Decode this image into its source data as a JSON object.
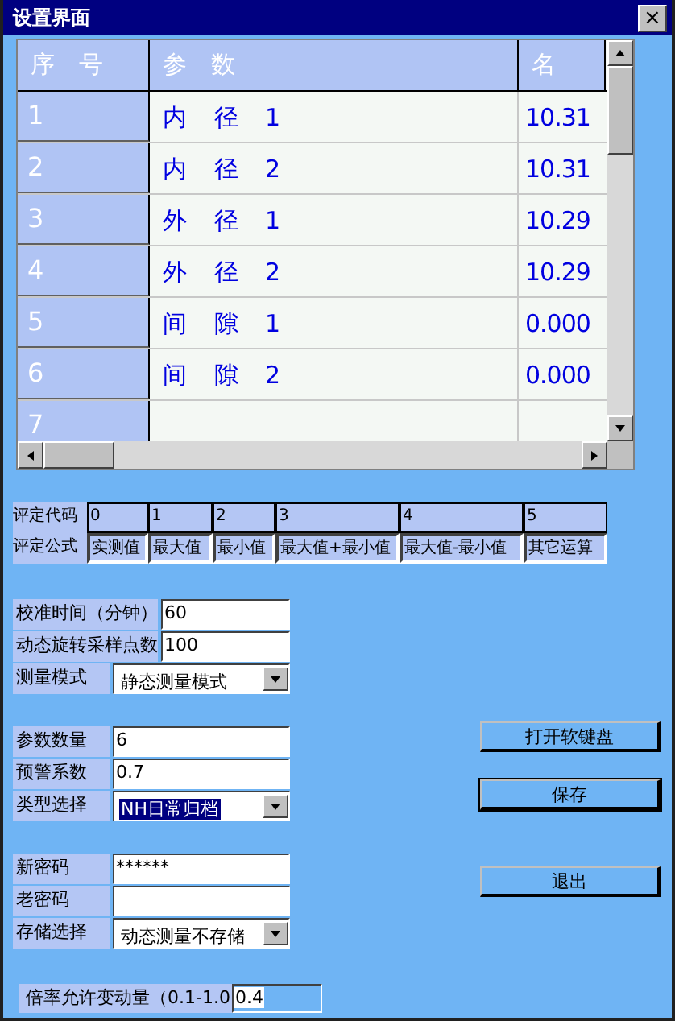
{
  "window": {
    "title": "设置界面",
    "close": "×"
  },
  "grid": {
    "columns": [
      "序 号",
      "参 数",
      "名"
    ],
    "rows": [
      {
        "index": "1",
        "param": "内 径 1",
        "value": "10.31"
      },
      {
        "index": "2",
        "param": "内 径 2",
        "value": "10.31"
      },
      {
        "index": "3",
        "param": "外 径 1",
        "value": "10.29"
      },
      {
        "index": "4",
        "param": "外 径 2",
        "value": "10.29"
      },
      {
        "index": "5",
        "param": "间 隙 1",
        "value": "0.000"
      },
      {
        "index": "6",
        "param": "间 隙 2",
        "value": "0.000"
      },
      {
        "index": "7"
      }
    ]
  },
  "codes": {
    "label": "评定代码",
    "cells": [
      "0",
      "1",
      "2",
      "3",
      "4",
      "5"
    ]
  },
  "formulas": {
    "label": "评定公式",
    "cells": [
      "实测值",
      "最大值",
      "最小值",
      "最大值+最小值",
      "最大值-最小值",
      "其它运算"
    ]
  },
  "form_groups": [
    [
      {
        "kind": "text",
        "label": "校准时间（分钟）",
        "value": "60"
      },
      {
        "kind": "text",
        "label": "动态旋转采样点数",
        "value": "100"
      },
      {
        "kind": "select",
        "label": "测量模式",
        "value": "静态测量模式",
        "selected": false
      }
    ],
    [
      {
        "kind": "text",
        "label": "参数数量",
        "value": "6"
      },
      {
        "kind": "text",
        "label": "预警系数",
        "value": "0.7"
      },
      {
        "kind": "select",
        "label": "类型选择",
        "value": "NH日常归档",
        "selected": true
      }
    ],
    [
      {
        "kind": "text",
        "label": "新密码",
        "value": "******"
      },
      {
        "kind": "text",
        "label": "老密码"
      },
      {
        "kind": "select",
        "label": "存储选择",
        "value": "动态测量不存储",
        "selected": false
      }
    ]
  ],
  "ratio": {
    "label": "倍率允许变动量（0.1-1.0",
    "value": "0.4"
  },
  "buttons": [
    {
      "label": "打开软键盘",
      "default": false
    },
    {
      "label": "保存",
      "default": true
    },
    {
      "label": "退出",
      "default": false
    }
  ]
}
